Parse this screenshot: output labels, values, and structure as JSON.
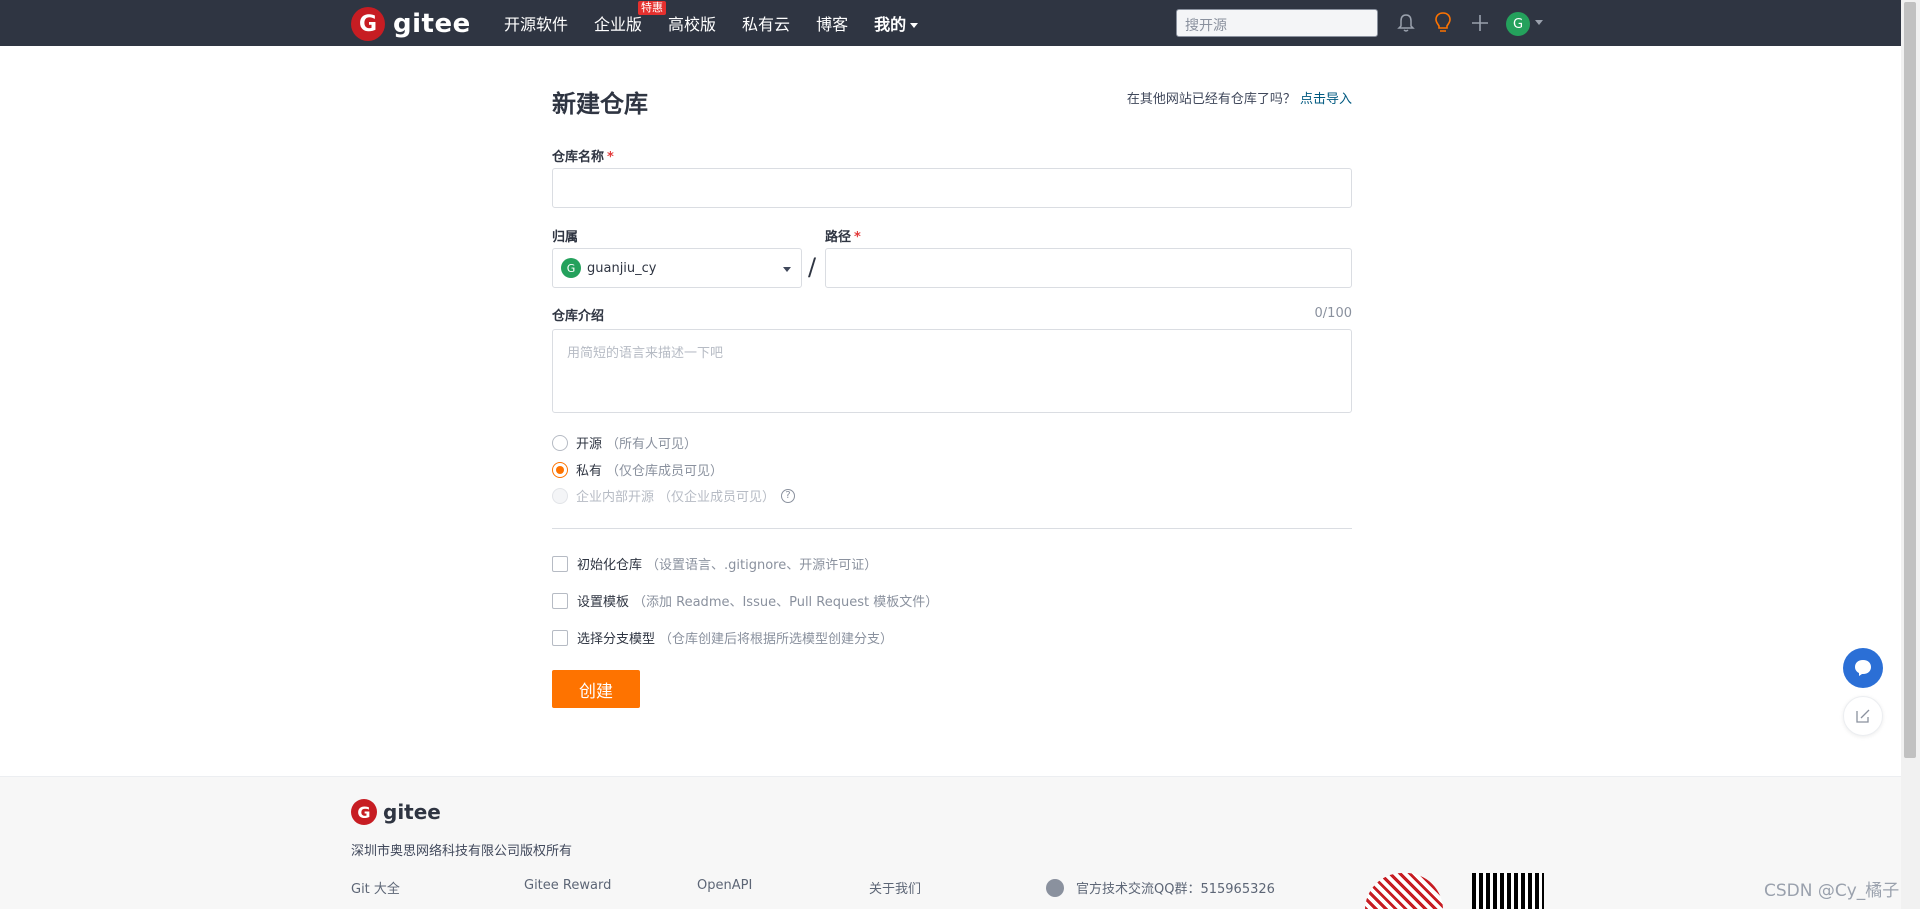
{
  "header": {
    "logo_text": "gitee",
    "nav": [
      {
        "label": "开源软件"
      },
      {
        "label": "企业版",
        "badge": "特惠"
      },
      {
        "label": "高校版"
      },
      {
        "label": "私有云"
      },
      {
        "label": "博客"
      },
      {
        "label": "我的"
      }
    ],
    "search_placeholder": "搜开源",
    "avatar_letter": "G",
    "icons": [
      "bell-icon",
      "lightbulb-icon",
      "plus-icon"
    ]
  },
  "form": {
    "title": "新建仓库",
    "import_hint": "在其他网站已经有仓库了吗？",
    "import_link": "点击导入",
    "name_label": "仓库名称",
    "required_mark": "*",
    "owner_label": "归属",
    "owner_avatar_letter": "G",
    "owner_value": "guanjiu_cy",
    "separator": "/",
    "path_label": "路径",
    "desc_label": "仓库介绍",
    "desc_counter": "0/100",
    "desc_placeholder": "用简短的语言来描述一下吧",
    "visibility": [
      {
        "label": "开源",
        "sub": "（所有人可见）",
        "checked": false,
        "disabled": false
      },
      {
        "label": "私有",
        "sub": "（仅仓库成员可见）",
        "checked": true,
        "disabled": false
      },
      {
        "label": "企业内部开源",
        "sub": "（仅企业成员可见）",
        "checked": false,
        "disabled": true
      }
    ],
    "options": [
      {
        "label": "初始化仓库",
        "sub": "（设置语言、.gitignore、开源许可证）",
        "checked": false
      },
      {
        "label": "设置模板",
        "sub": "（添加 Readme、Issue、Pull Request 模板文件）",
        "checked": false
      },
      {
        "label": "选择分支模型",
        "sub": "（仓库创建后将根据所选模型创建分支）",
        "checked": false
      }
    ],
    "submit_label": "创建"
  },
  "footer": {
    "logo_text": "gitee",
    "copyright": "深圳市奥思网络科技有限公司版权所有",
    "links": [
      "Git 大全",
      "Gitee Reward",
      "OpenAPI",
      "关于我们"
    ],
    "qq_group": "官方技术交流QQ群：515965326"
  },
  "watermark": "CSDN @Cy_橘子",
  "colors": {
    "nav_bg": "#2f3542",
    "accent": "#fe7300",
    "brand_red": "#c71d23",
    "link": "#005980"
  }
}
